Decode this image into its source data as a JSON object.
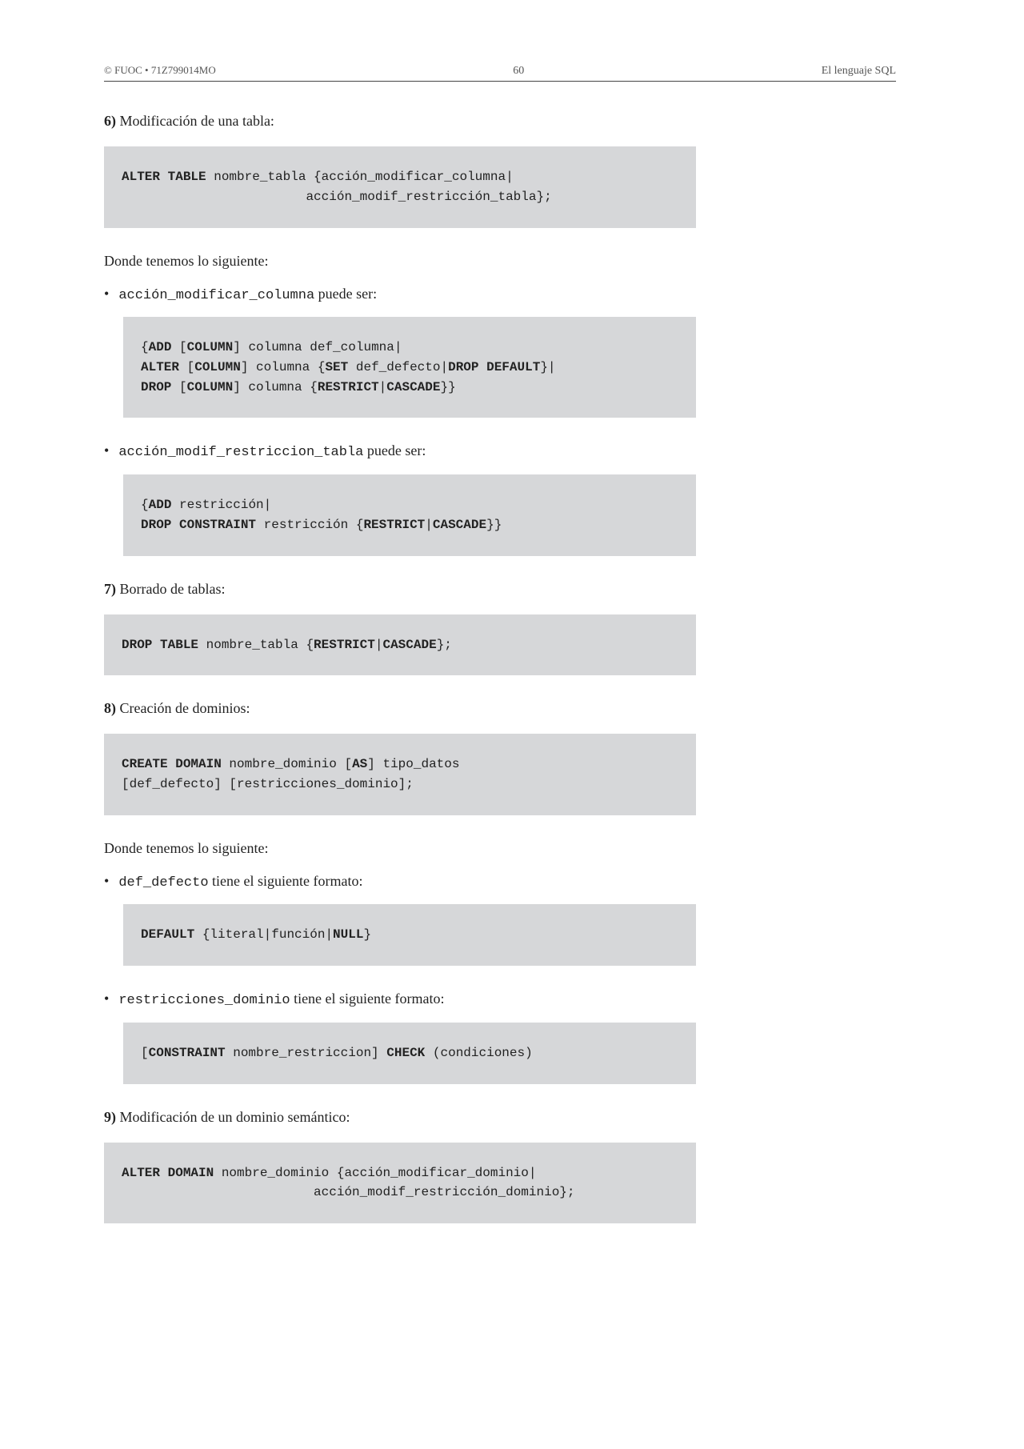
{
  "header": {
    "left": "© FUOC • 71Z799014MO",
    "center": "60",
    "right": "El lenguaje SQL"
  },
  "sections": {
    "s6": {
      "num": "6)",
      "title": "Modificación de una tabla:"
    },
    "s7": {
      "num": "7)",
      "title": "Borrado de tablas:"
    },
    "s8": {
      "num": "8)",
      "title": "Creación de dominios:"
    },
    "s9": {
      "num": "9)",
      "title": "Modificación de un dominio semántico:"
    }
  },
  "para": {
    "donde1": "Donde tenemos lo siguiente:",
    "donde2": "Donde tenemos lo siguiente:"
  },
  "bullets": {
    "b1_code": "acción_modificar_columna",
    "b1_text": " puede ser:",
    "b2_code": "acción_modif_restriccion_tabla",
    "b2_text": " puede ser:",
    "b3_code": "def_defecto",
    "b3_text": " tiene el siguiente formato:",
    "b4_code": "restricciones_dominio",
    "b4_text": " tiene el siguiente formato:"
  },
  "code": {
    "c1_kw1": "ALTER TABLE",
    "c1_p1": " nombre_tabla {acción_modificar_columna|",
    "c1_p2": "                        acción_modif_restricción_tabla};",
    "c2_open": "{",
    "c2_kw1": "ADD",
    "c2_p1a": " [",
    "c2_kw2": "COLUMN",
    "c2_p1b": "] columna def_columna|",
    "c2_kw3": "ALTER",
    "c2_p2a": " [",
    "c2_kw4": "COLUMN",
    "c2_p2b": "] columna {",
    "c2_kw5": "SET",
    "c2_p2c": " def_defecto|",
    "c2_kw6": "DROP DEFAULT",
    "c2_p2d": "}|",
    "c2_kw7": "DROP",
    "c2_p3a": " [",
    "c2_kw8": "COLUMN",
    "c2_p3b": "] columna {",
    "c2_kw9": "RESTRICT",
    "c2_p3c": "|",
    "c2_kw10": "CASCADE",
    "c2_p3d": "}}",
    "c3_open": "{",
    "c3_kw1": "ADD",
    "c3_p1a": " restricción|",
    "c3_kw2": "DROP CONSTRAINT",
    "c3_p2a": " restricción {",
    "c3_kw3": "RESTRICT",
    "c3_p2b": "|",
    "c3_kw4": "CASCADE",
    "c3_p2c": "}}",
    "c4_kw1": "DROP TABLE",
    "c4_p1": " nombre_tabla {",
    "c4_kw2": "RESTRICT",
    "c4_p2": "|",
    "c4_kw3": "CASCADE",
    "c4_p3": "};",
    "c5_kw1": "CREATE DOMAIN",
    "c5_p1": " nombre_dominio [",
    "c5_kw2": "AS",
    "c5_p2": "] tipo_datos",
    "c5_p3": "[def_defecto] [restricciones_dominio];",
    "c6_kw1": "DEFAULT",
    "c6_p1": " {literal|función|",
    "c6_kw2": "NULL",
    "c6_p2": "}",
    "c7_p1": "[",
    "c7_kw1": "CONSTRAINT",
    "c7_p2": " nombre_restriccion] ",
    "c7_kw2": "CHECK",
    "c7_p3": " (condiciones)",
    "c8_kw1": "ALTER DOMAIN",
    "c8_p1": " nombre_dominio {acción_modificar_dominio|",
    "c8_p2": "                         acción_modif_restricción_dominio};"
  }
}
